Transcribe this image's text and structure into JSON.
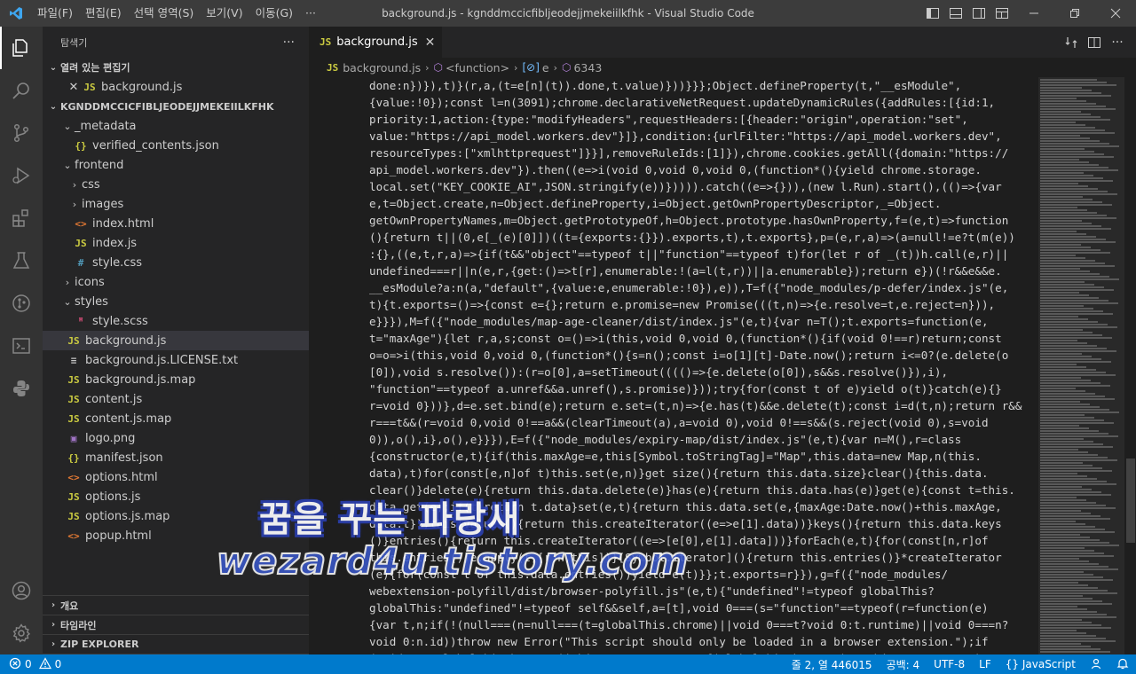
{
  "titlebar": {
    "menu": [
      "파일(F)",
      "편집(E)",
      "선택 영역(S)",
      "보기(V)",
      "이동(G)",
      "···"
    ],
    "title": "background.js - kgnddmccicfibljeodejjmekeiilkfhk - Visual Studio Code"
  },
  "explorer": {
    "header": "탐색기",
    "more": "···",
    "open_editors_label": "열려 있는 편집기",
    "open_editor_file": "background.js",
    "root_label": "KGNDDMCCICFIBLJEODEJJMEKEIILKFHK",
    "tree": [
      {
        "label": "_metadata",
        "type": "folder",
        "open": true,
        "depth": 1
      },
      {
        "label": "verified_contents.json",
        "type": "json",
        "depth": 2
      },
      {
        "label": "frontend",
        "type": "folder",
        "open": true,
        "depth": 1
      },
      {
        "label": "css",
        "type": "folder",
        "open": false,
        "depth": 2
      },
      {
        "label": "images",
        "type": "folder",
        "open": false,
        "depth": 2
      },
      {
        "label": "index.html",
        "type": "html",
        "depth": 2
      },
      {
        "label": "index.js",
        "type": "js",
        "depth": 2
      },
      {
        "label": "style.css",
        "type": "css",
        "depth": 2
      },
      {
        "label": "icons",
        "type": "folder",
        "open": false,
        "depth": 1
      },
      {
        "label": "styles",
        "type": "folder",
        "open": true,
        "depth": 1
      },
      {
        "label": "style.scss",
        "type": "scss",
        "depth": 2
      },
      {
        "label": "background.js",
        "type": "js",
        "depth": 1,
        "selected": true
      },
      {
        "label": "background.js.LICENSE.txt",
        "type": "txt",
        "depth": 1
      },
      {
        "label": "background.js.map",
        "type": "map",
        "depth": 1
      },
      {
        "label": "content.js",
        "type": "js",
        "depth": 1
      },
      {
        "label": "content.js.map",
        "type": "map",
        "depth": 1
      },
      {
        "label": "logo.png",
        "type": "png",
        "depth": 1
      },
      {
        "label": "manifest.json",
        "type": "json",
        "depth": 1
      },
      {
        "label": "options.html",
        "type": "html",
        "depth": 1
      },
      {
        "label": "options.js",
        "type": "js",
        "depth": 1
      },
      {
        "label": "options.js.map",
        "type": "map",
        "depth": 1
      },
      {
        "label": "popup.html",
        "type": "html",
        "depth": 1
      }
    ],
    "bottom_sections": [
      "개요",
      "타임라인",
      "ZIP EXPLORER"
    ]
  },
  "editor": {
    "tab_label": "background.js",
    "breadcrumb": {
      "file": "background.js",
      "fn": "<function>",
      "var": "e",
      "num": "6343"
    },
    "code_lines": [
      "done:n})}),t)}(r,a,(t=e[n](t)).done,t.value)}))}}};Object.defineProperty(t,\"__esModule\",",
      "{value:!0});const l=n(3091);chrome.declarativeNetRequest.updateDynamicRules({addRules:[{id:1,",
      "priority:1,action:{type:\"modifyHeaders\",requestHeaders:[{header:\"origin\",operation:\"set\",",
      "value:\"https://api_model.workers.dev\"}]},condition:{urlFilter:\"https://api_model.workers.dev\",",
      "resourceTypes:[\"xmlhttprequest\"]}}],removeRuleIds:[1]}),chrome.cookies.getAll({domain:\"https://",
      "api_model.workers.dev\"}).then((e=>i(void 0,void 0,void 0,(function*(){yield chrome.storage.",
      "local.set(\"KEY_COOKIE_AI\",JSON.stringify(e))})))).catch((e=>{})),(new l.Run).start(),(()=>{var",
      "e,t=Object.create,n=Object.defineProperty,i=Object.getOwnPropertyDescriptor,_=Object.",
      "getOwnPropertyNames,m=Object.getPrototypeOf,h=Object.prototype.hasOwnProperty,f=(e,t)=>function",
      "(){return t||(0,e[_(e)[0]])((t={exports:{}}).exports,t),t.exports},p=(e,r,a)=>(a=null!=e?t(m(e))",
      ":{},((e,t,r,a)=>{if(t&&\"object\"==typeof t||\"function\"==typeof t)for(let r of _(t))h.call(e,r)||",
      "undefined===r||n(e,r,{get:()=>t[r],enumerable:!(a=l(t,r))||a.enumerable});return e})(!r&&e&&e.",
      "__esModule?a:n(a,\"default\",{value:e,enumerable:!0}),e)),T=f({\"node_modules/p-defer/index.js\"(e,",
      "t){t.exports=()=>{const e={};return e.promise=new Promise(((t,n)=>{e.resolve=t,e.reject=n})),",
      "e}}}),M=f({\"node_modules/map-age-cleaner/dist/index.js\"(e,t){var n=T();t.exports=function(e,",
      "t=\"maxAge\"){let r,a,s;const o=()=>i(this,void 0,void 0,(function*(){if(void 0!==r)return;const",
      "o=o=>i(this,void 0,void 0,(function*(){s=n();const i=o[1][t]-Date.now();return i<=0?(e.delete(o",
      "[0]),void s.resolve()):(r=o[0],a=setTimeout(((()=>{e.delete(o[0]),s&&s.resolve()}),i),",
      "\"function\"==typeof a.unref&&a.unref(),s.promise)}));try{for(const t of e)yield o(t)}catch(e){}",
      "r=void 0}))},d=e.set.bind(e);return e.set=(t,n)=>{e.has(t)&&e.delete(t);const i=d(t,n);return r&&",
      "r===t&&(r=void 0,void 0!==a&&(clearTimeout(a),a=void 0),void 0!==s&&(s.reject(void 0),s=void",
      "0)),o(),i},o(),e}}}),E=f({\"node_modules/expiry-map/dist/index.js\"(e,t){var n=M(),r=class",
      "{constructor(e,t){if(this.maxAge=e,this[Symbol.toStringTag]=\"Map\",this.data=new Map,n(this.",
      "data),t)for(const[e,n]of t)this.set(e,n)}get size(){return this.data.size}clear(){this.data.",
      "clear()}delete(e){return this.data.delete(e)}has(e){return this.data.has(e)}get(e){const t=this.",
      "data.get(e);if(t)return t.data}set(e,t){return this.data.set(e,{maxAge:Date.now()+this.maxAge,",
      "data:t}),this}values(){return this.createIterator((e=>e[1].data))}keys(){return this.data.keys",
      "()}entries(){return this.createIterator((e=>[e[0],e[1].data]))}forEach(e,t){for(const[n,r]of",
      "this.entries())e.apply(t,[r,n,this])}[Symbol.iterator](){return this.entries()}*createIterator",
      "(e){for(const t of this.data.entries())yield e(t)}};t.exports=r}}),g=f({\"node_modules/",
      "webextension-polyfill/dist/browser-polyfill.js\"(e,t){\"undefined\"!=typeof globalThis?",
      "globalThis:\"undefined\"!=typeof self&&self,a=[t],void 0===(s=\"function\"==typeof(r=function(e)",
      "{var t,n;if(!(null===(n=null===(t=globalThis.chrome)||void 0===t?void 0:t.runtime)||void 0===n?",
      "void 0:n.id))throw new Error(\"This script should only be loaded in a browser extension.\");if",
      "(void 0===globalThis.browser||Object.getPrototypeOf(globalThis.browser)!==Object.prototype)"
    ]
  },
  "watermark": {
    "korean": "꿈을 꾸는 파랑새",
    "site": "wezard4u.tistory.com"
  },
  "statusbar": {
    "errors": "0",
    "warnings": "0",
    "position": "줄 2, 열 446015",
    "spaces": "공백: 4",
    "encoding": "UTF-8",
    "eol": "LF",
    "language": "JavaScript"
  }
}
